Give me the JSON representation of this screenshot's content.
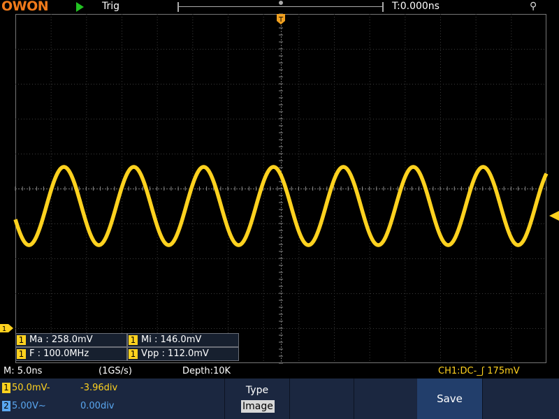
{
  "header": {
    "logo": "OWON",
    "run_state": "Trig",
    "trigger_time": "T:0.000ns",
    "trigger_marker": "T"
  },
  "colors": {
    "ch1": "#ffd21f",
    "ch2": "#5aa7f0",
    "logo": "#f07a1a",
    "trigger": "#f0a020",
    "run": "#22c322"
  },
  "waveform": {
    "amplitude_div": 1.12,
    "center_div": -0.5,
    "frequency": "100.0MHz",
    "timebase_ns_per_div": 5,
    "cycles_on_screen": 7.6,
    "phase_deg": 200
  },
  "measurements": [
    {
      "ch": "1",
      "label": "Ma : 258.0mV"
    },
    {
      "ch": "1",
      "label": "Mi : 146.0mV"
    },
    {
      "ch": "1",
      "label": "F : 100.0MHz"
    },
    {
      "ch": "1",
      "label": "Vpp : 112.0mV"
    }
  ],
  "status": {
    "timebase": "M: 5.0ns",
    "sample_rate": "(1GS/s)",
    "depth": "Depth:10K",
    "trigger_info": "CH1:DC-_ʃ 175mV"
  },
  "channels": [
    {
      "num": "1",
      "scale": "50.0mV-",
      "offset": "-3.96div"
    },
    {
      "num": "2",
      "scale": "5.00V~",
      "offset": "0.00div"
    }
  ],
  "menu": {
    "type_label": "Type",
    "type_value": "Image",
    "save_label": "Save"
  }
}
